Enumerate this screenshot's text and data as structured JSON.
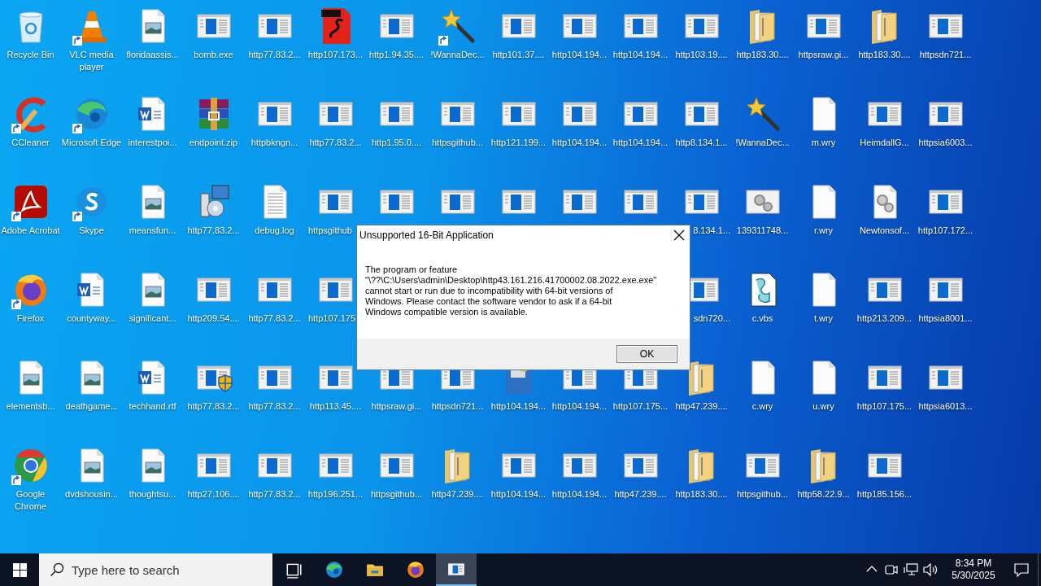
{
  "desktop": {
    "rows": [
      {
        "cells": [
          {
            "kind": "recycle",
            "label": "Recycle Bin",
            "shortcut": false
          },
          {
            "kind": "cone",
            "label": "VLC media player",
            "shortcut": true
          },
          {
            "kind": "image",
            "label": "floridaassis...",
            "shortcut": false
          },
          {
            "kind": "app",
            "label": "bomb.exe",
            "shortcut": false
          },
          {
            "kind": "app",
            "label": "http77.83.2...",
            "shortcut": false
          },
          {
            "kind": "pdf",
            "label": "http107.173...",
            "shortcut": false
          },
          {
            "kind": "app",
            "label": "http1.94.35....",
            "shortcut": false
          },
          {
            "kind": "wand",
            "label": "!WannaDec...",
            "shortcut": true
          },
          {
            "kind": "app",
            "label": "http101.37....",
            "shortcut": false
          },
          {
            "kind": "app",
            "label": "http104.194...",
            "shortcut": false
          },
          {
            "kind": "app",
            "label": "http104.194...",
            "shortcut": false
          },
          {
            "kind": "app",
            "label": "http103.19....",
            "shortcut": false
          },
          {
            "kind": "folder",
            "label": "http183.30....",
            "shortcut": false
          },
          {
            "kind": "app",
            "label": "httpsraw.gi...",
            "shortcut": false
          },
          {
            "kind": "folder",
            "label": "http183.30....",
            "shortcut": false
          },
          {
            "kind": "app",
            "label": "httpsdn721...",
            "shortcut": false
          }
        ]
      },
      {
        "cells": [
          {
            "kind": "ccleaner",
            "label": "CCleaner",
            "shortcut": true
          },
          {
            "kind": "edge",
            "label": "Microsoft Edge",
            "shortcut": true
          },
          {
            "kind": "word",
            "label": "interestpoi...",
            "shortcut": false
          },
          {
            "kind": "archive",
            "label": "endpoint.zip",
            "shortcut": false
          },
          {
            "kind": "app",
            "label": "httpbkngn...",
            "shortcut": false
          },
          {
            "kind": "app",
            "label": "http77.83.2...",
            "shortcut": false
          },
          {
            "kind": "app",
            "label": "http1.95.0....",
            "shortcut": false
          },
          {
            "kind": "app",
            "label": "httpsgithub...",
            "shortcut": false
          },
          {
            "kind": "app",
            "label": "http121.199...",
            "shortcut": false
          },
          {
            "kind": "app",
            "label": "http104.194...",
            "shortcut": false
          },
          {
            "kind": "app",
            "label": "http104.194...",
            "shortcut": false
          },
          {
            "kind": "app",
            "label": "http8.134.1...",
            "shortcut": false
          },
          {
            "kind": "wand",
            "label": "!WannaDec...",
            "shortcut": false
          },
          {
            "kind": "blank",
            "label": "m.wry",
            "shortcut": false
          },
          {
            "kind": "app",
            "label": "HeimdallG...",
            "shortcut": false
          },
          {
            "kind": "app",
            "label": "httpsia6003...",
            "shortcut": false
          }
        ]
      },
      {
        "cells": [
          {
            "kind": "acrobat",
            "label": "Adobe Acrobat",
            "shortcut": true
          },
          {
            "kind": "skype",
            "label": "Skype",
            "shortcut": true
          },
          {
            "kind": "image",
            "label": "meansfun...",
            "shortcut": false
          },
          {
            "kind": "setup",
            "label": "http77.83.2...",
            "shortcut": false
          },
          {
            "kind": "log",
            "label": "debug.log",
            "shortcut": false
          },
          {
            "kind": "app",
            "label": "httpsgithub",
            "shortcut": false
          },
          {
            "kind": "app",
            "shortcut": false
          },
          {
            "kind": "app",
            "shortcut": false
          },
          {
            "kind": "app",
            "shortcut": false
          },
          {
            "kind": "app",
            "shortcut": false
          },
          {
            "kind": "app",
            "shortcut": false
          },
          {
            "kind": "app",
            "label": "8.134.1...",
            "shortcut": false
          },
          {
            "kind": "gearswin",
            "label": "139311748...",
            "shortcut": false
          },
          {
            "kind": "blank",
            "label": "r.wry",
            "shortcut": false
          },
          {
            "kind": "gearsdoc",
            "label": "Newtonsof...",
            "shortcut": false
          },
          {
            "kind": "app",
            "label": "http107.172...",
            "shortcut": false
          }
        ]
      },
      {
        "cells": [
          {
            "kind": "firefox",
            "label": "Firefox",
            "shortcut": true
          },
          {
            "kind": "word",
            "label": "countyway...",
            "shortcut": false
          },
          {
            "kind": "image",
            "label": "significant...",
            "shortcut": false
          },
          {
            "kind": "app",
            "label": "http209.54....",
            "shortcut": false
          },
          {
            "kind": "app",
            "label": "http77.83.2...",
            "shortcut": false
          },
          {
            "kind": "app",
            "label": "http107.175",
            "shortcut": false
          },
          {
            "kind": "none"
          },
          {
            "kind": "none"
          },
          {
            "kind": "none"
          },
          {
            "kind": "none"
          },
          {
            "kind": "none"
          },
          {
            "kind": "app",
            "label": "sdn720...",
            "shortcut": false
          },
          {
            "kind": "vbs",
            "label": "c.vbs",
            "shortcut": false
          },
          {
            "kind": "blank",
            "label": "t.wry",
            "shortcut": false
          },
          {
            "kind": "app",
            "label": "http213.209...",
            "shortcut": false
          },
          {
            "kind": "app",
            "label": "httpsia8001...",
            "shortcut": false
          }
        ]
      },
      {
        "cells": [
          {
            "kind": "image",
            "label": "elementsb...",
            "shortcut": false
          },
          {
            "kind": "image",
            "label": "deathgame...",
            "shortcut": false
          },
          {
            "kind": "word",
            "label": "techhand.rtf",
            "shortcut": false
          },
          {
            "kind": "appshield",
            "label": "http77.83.2...",
            "shortcut": false
          },
          {
            "kind": "app",
            "label": "http77.83.2...",
            "shortcut": false
          },
          {
            "kind": "app",
            "label": "http113.45....",
            "shortcut": false
          },
          {
            "kind": "app",
            "label": "httpsraw.gi...",
            "shortcut": false
          },
          {
            "kind": "app",
            "label": "httpsdn721...",
            "shortcut": false
          },
          {
            "kind": "floppy",
            "label": "http104.194...",
            "shortcut": false
          },
          {
            "kind": "app",
            "label": "http104.194...",
            "shortcut": false
          },
          {
            "kind": "app",
            "label": "http107.175...",
            "shortcut": false
          },
          {
            "kind": "folder",
            "label": "http47.239....",
            "shortcut": false
          },
          {
            "kind": "blank",
            "label": "c.wry",
            "shortcut": false
          },
          {
            "kind": "blank",
            "label": "u.wry",
            "shortcut": false
          },
          {
            "kind": "app",
            "label": "http107.175...",
            "shortcut": false
          },
          {
            "kind": "app",
            "label": "httpsia6013...",
            "shortcut": false
          }
        ]
      },
      {
        "cells": [
          {
            "kind": "chrome",
            "label": "Google Chrome",
            "shortcut": true
          },
          {
            "kind": "image",
            "label": "dvdshousin...",
            "shortcut": false
          },
          {
            "kind": "image",
            "label": "thoughtsu...",
            "shortcut": false
          },
          {
            "kind": "app",
            "label": "http27.106....",
            "shortcut": false
          },
          {
            "kind": "app",
            "label": "http77.83.2...",
            "shortcut": false
          },
          {
            "kind": "app",
            "label": "http196.251...",
            "shortcut": false
          },
          {
            "kind": "app",
            "label": "httpsgithub...",
            "shortcut": false
          },
          {
            "kind": "folder",
            "label": "http47.239....",
            "shortcut": false
          },
          {
            "kind": "app",
            "label": "http104.194...",
            "shortcut": false
          },
          {
            "kind": "app",
            "label": "http104.194...",
            "shortcut": false
          },
          {
            "kind": "app",
            "label": "http47.239....",
            "shortcut": false
          },
          {
            "kind": "folder",
            "label": "http183.30....",
            "shortcut": false
          },
          {
            "kind": "app",
            "label": "httpsgithub...",
            "shortcut": false
          },
          {
            "kind": "folder",
            "label": "http58.22.9...",
            "shortcut": false
          },
          {
            "kind": "app",
            "label": "http185.156...",
            "shortcut": false
          }
        ]
      }
    ]
  },
  "dialog": {
    "title": "Unsupported 16-Bit Application",
    "message": "The program or feature\n\"\\??\\C:\\Users\\admin\\Desktop\\http43.161.216.41700002.08.2022.exe.exe\"\ncannot start or run due to incompatibility with 64-bit versions of\nWindows. Please contact the software vendor to ask if a 64-bit\nWindows compatible version is available.",
    "button": "OK"
  },
  "taskbar": {
    "search": {
      "placeholder": "Type here to search"
    },
    "apps": [
      {
        "kind": "task_view",
        "selected": false
      },
      {
        "kind": "edge",
        "selected": false
      },
      {
        "kind": "explorer",
        "selected": false
      },
      {
        "kind": "firefox",
        "selected": false
      },
      {
        "kind": "app",
        "selected": true
      }
    ],
    "tray": [
      {
        "kind": "chevron"
      },
      {
        "kind": "meet"
      },
      {
        "kind": "network"
      },
      {
        "kind": "volume"
      }
    ],
    "time": "8:34 PM",
    "date": "5/30/2025"
  }
}
